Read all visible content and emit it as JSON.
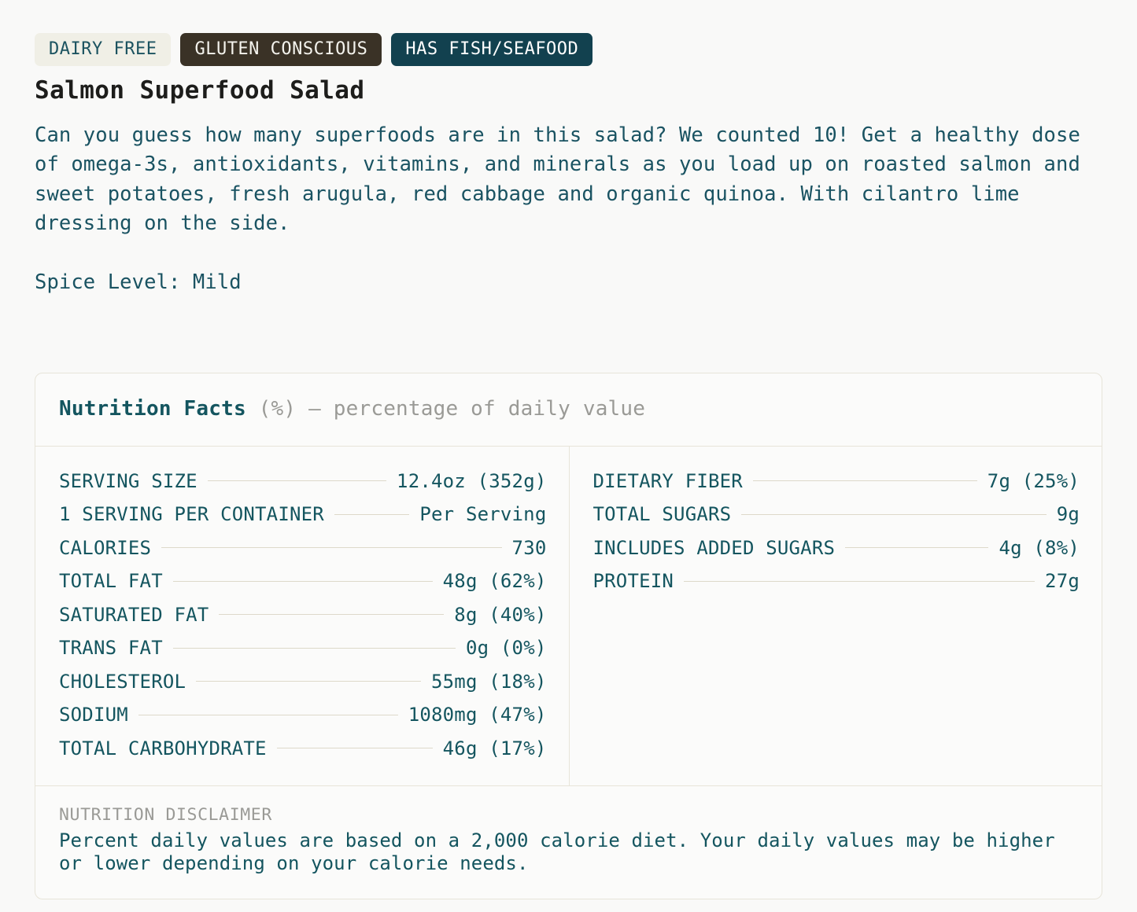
{
  "badges": [
    {
      "label": "DAIRY FREE",
      "style": "light"
    },
    {
      "label": "GLUTEN CONSCIOUS",
      "style": "dark"
    },
    {
      "label": "HAS FISH/SEAFOOD",
      "style": "teal"
    }
  ],
  "item": {
    "title": "Salmon Superfood Salad",
    "description": "Can you guess how many superfoods are in this salad? We counted 10! Get a healthy dose of omega-3s, antioxidants, vitamins, and minerals as you load up on roasted salmon and sweet potatoes, fresh arugula, red cabbage and organic quinoa. With cilantro lime dressing on the side.",
    "spice_level": "Spice Level: Mild"
  },
  "nutrition": {
    "heading_main": "Nutrition Facts ",
    "heading_sub": "(%) – percentage of daily value",
    "left_rows": [
      {
        "label": "SERVING SIZE",
        "value": "12.4oz (352g)"
      },
      {
        "label": "1 SERVING PER CONTAINER",
        "value": "Per Serving"
      },
      {
        "label": "CALORIES",
        "value": "730"
      },
      {
        "label": "TOTAL FAT",
        "value": "48g (62%)"
      },
      {
        "label": "SATURATED FAT",
        "value": "8g (40%)"
      },
      {
        "label": "TRANS FAT",
        "value": "0g (0%)"
      },
      {
        "label": "CHOLESTEROL",
        "value": "55mg (18%)"
      },
      {
        "label": "SODIUM",
        "value": "1080mg (47%)"
      },
      {
        "label": "TOTAL CARBOHYDRATE",
        "value": "46g (17%)"
      }
    ],
    "right_rows": [
      {
        "label": "DIETARY FIBER",
        "value": "7g (25%)"
      },
      {
        "label": "TOTAL SUGARS",
        "value": "9g"
      },
      {
        "label": "INCLUDES ADDED SUGARS",
        "value": "4g (8%)"
      },
      {
        "label": "PROTEIN",
        "value": "27g"
      }
    ],
    "disclaimer_title": "NUTRITION DISCLAIMER",
    "disclaimer_body": "Percent daily values are based on a 2,000 calorie diet. Your daily values may be higher or lower depending on your calorie needs."
  },
  "colors": {
    "page_bg": "#F9F9F8",
    "teal_text": "#14555F",
    "badge_light_bg": "#F0EFE6",
    "badge_dark_bg": "#3A3226",
    "badge_teal_bg": "#12414F",
    "border": "#E7E4D9",
    "leader": "#DDD9CA",
    "muted": "#9A9A96",
    "title": "#1D1D1B"
  }
}
